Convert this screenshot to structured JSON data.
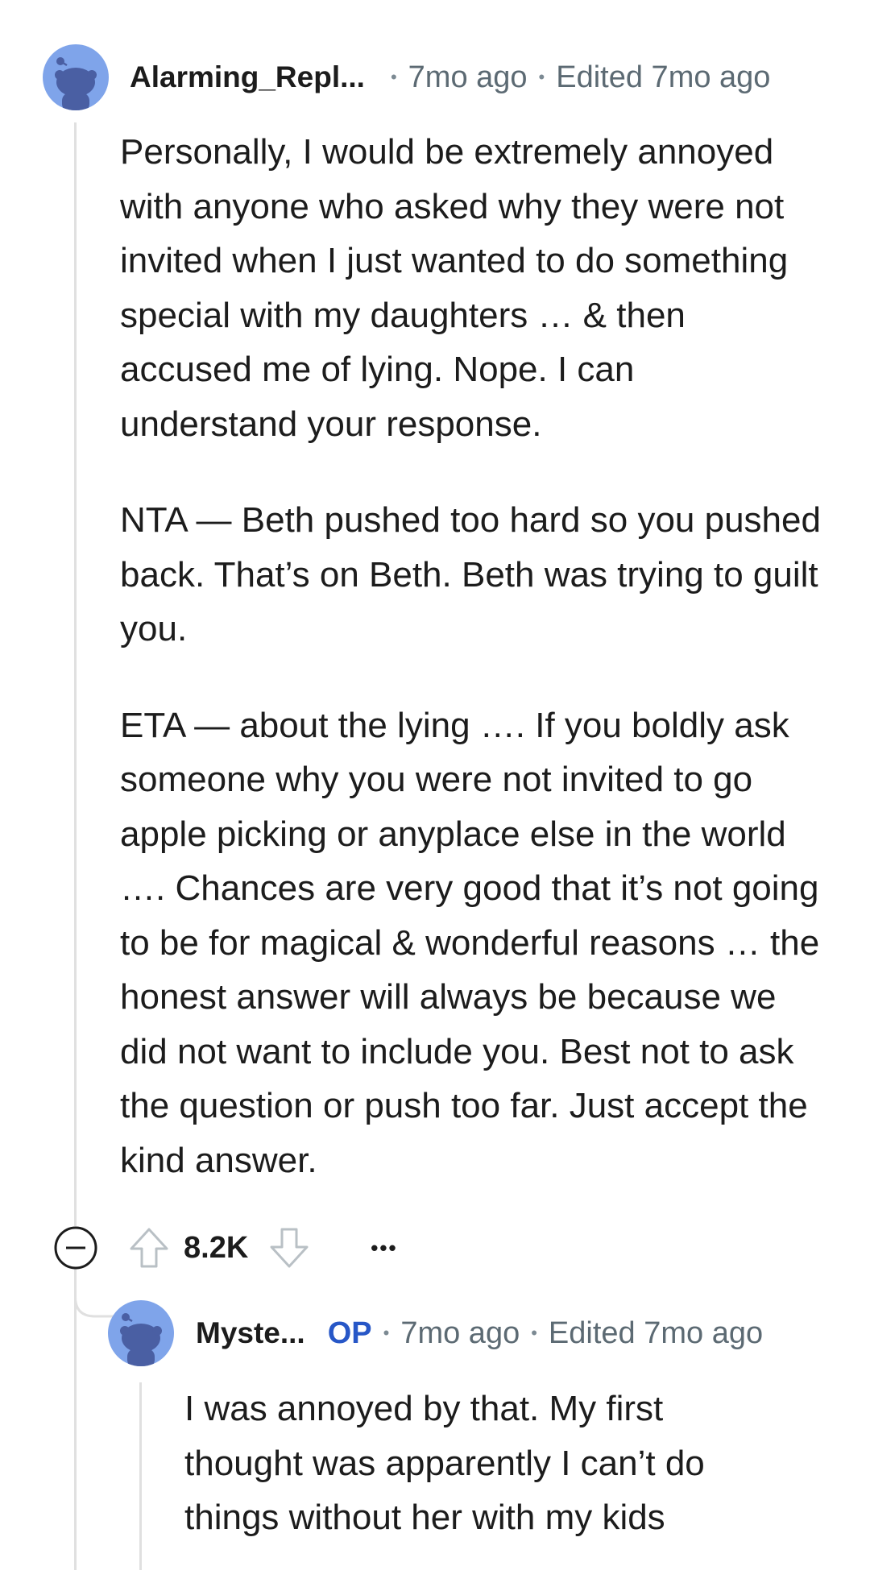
{
  "comment": {
    "username": "Alarming_Repl...",
    "time": "7mo ago",
    "edited": "Edited 7mo ago",
    "paragraphs": [
      "Personally, I would be extremely annoyed with anyone who asked why they were not invited when I just wanted to do something special with my daughters … & then accused me of lying. Nope. I can understand your response.",
      "NTA — Beth pushed too hard so you pushed back. That’s on Beth. Beth was trying to guilt you.",
      "ETA — about the lying …. If you boldly ask someone why you were not invited to go apple picking or anyplace else in the world …. Chances are very good that it’s not going to be for magical & wonderful reasons … the honest answer will always be because we did not want to include you. Best not to ask the question or push too far. Just accept the kind answer."
    ],
    "score": "8.2K",
    "more_label": "•••"
  },
  "reply": {
    "username": "Myste...",
    "op_badge": "OP",
    "time": "7mo ago",
    "edited": "Edited 7mo ago",
    "paragraphs": [
      "I was annoyed by that. My first thought was apparently I can’t do things without her with my kids"
    ]
  },
  "colors": {
    "avatar_bg": "#7fa4ea",
    "snoo_body": "#4a5fa3",
    "op_blue": "#2757c7",
    "meta_gray": "#5c6a73",
    "thread_line": "#e0e0e0"
  },
  "icons": {
    "avatar": "snoo-avatar-icon",
    "collapse": "collapse-minus-icon",
    "upvote": "upvote-arrow-icon",
    "downvote": "downvote-arrow-icon",
    "more": "more-dots-icon"
  }
}
